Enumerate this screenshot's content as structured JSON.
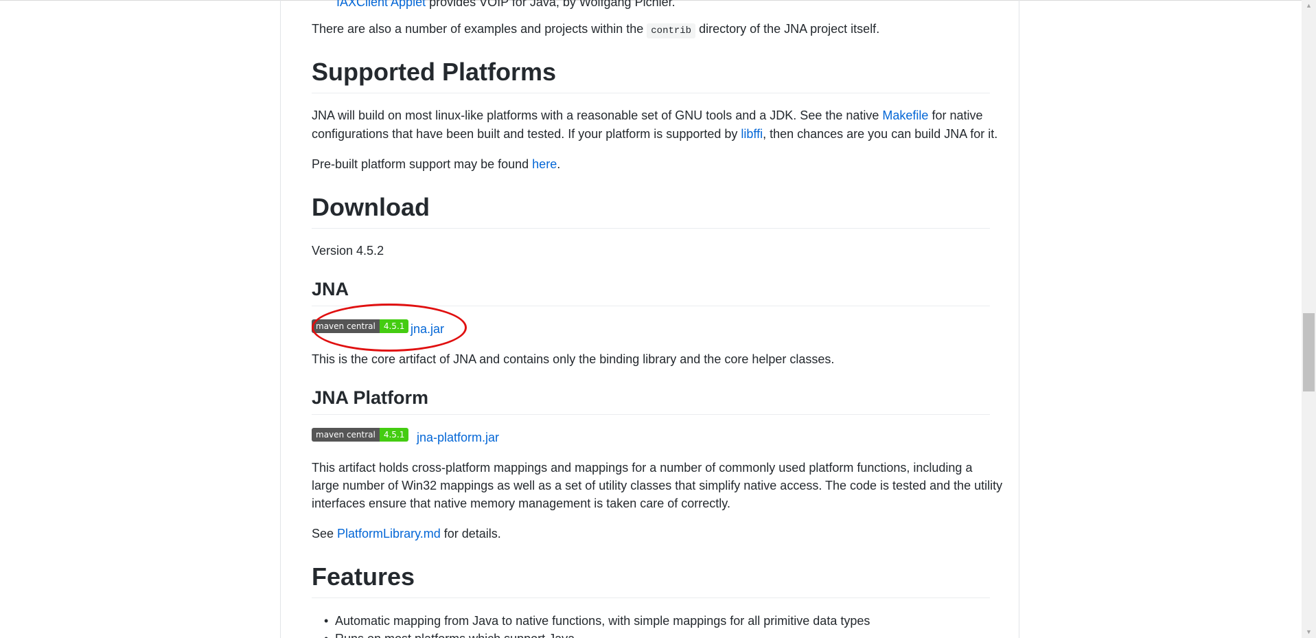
{
  "intro": {
    "cut_link": "IAXClient Applet",
    "cut_rest": " provides VOIP for Java, by Wolfgang Pichler.",
    "contrib_pre": "There are also a number of examples and projects within the ",
    "contrib_code": "contrib",
    "contrib_post": " directory of the JNA project itself."
  },
  "platforms": {
    "heading": "Supported Platforms",
    "p1_a": "JNA will build on most linux-like platforms with a reasonable set of GNU tools and a JDK. See the native ",
    "p1_link1": "Makefile",
    "p1_b": " for native",
    "p1_c": "configurations that have been built and tested. If your platform is supported by ",
    "p1_link2": "libffi",
    "p1_d": ", then chances are you can build JNA for it.",
    "p2_a": "Pre-built platform support may be found ",
    "p2_link": "here",
    "p2_b": "."
  },
  "download": {
    "heading": "Download",
    "version": "Version 4.5.2"
  },
  "jna": {
    "heading": "JNA",
    "badge_left": "maven central",
    "badge_right": "4.5.1",
    "jar_link": "jna.jar",
    "desc": "This is the core artifact of JNA and contains only the binding library and the core helper classes."
  },
  "jna_platform": {
    "heading": "JNA Platform",
    "badge_left": "maven central",
    "badge_right": "4.5.1",
    "jar_link": "jna-platform.jar",
    "desc1": "This artifact holds cross-platform mappings and mappings for a number of commonly used platform functions, including a",
    "desc2": "large number of Win32 mappings as well as a set of utility classes that simplify native access. The code is tested and the utility",
    "desc3": "interfaces ensure that native memory management is taken care of correctly.",
    "see_a": "See ",
    "see_link": "PlatformLibrary.md",
    "see_b": " for details."
  },
  "features": {
    "heading": "Features",
    "bullet": "•",
    "items": [
      "Automatic mapping from Java to native functions, with simple mappings for all primitive data types",
      "Runs on most platforms which support Java"
    ]
  },
  "colors": {
    "link": "#0366d6",
    "badge_left": "#555555",
    "badge_right": "#44cc11",
    "annotation": "#e01010"
  }
}
